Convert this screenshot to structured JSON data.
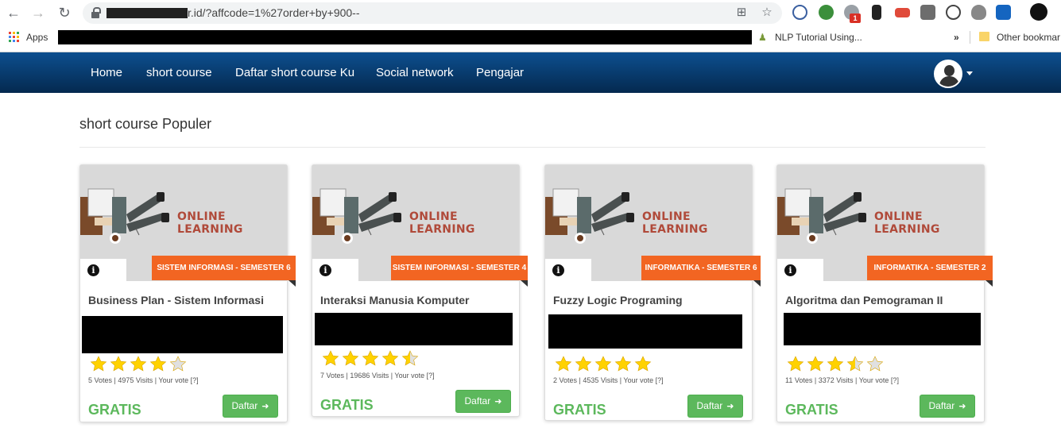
{
  "browser": {
    "url": "r.id/?affcode=1%27order+by+900--",
    "ext_badge": "1",
    "bookmarks": {
      "apps_label": "Apps",
      "item1": "NLP Tutorial Using...",
      "more": "»",
      "other": "Other bookmar"
    }
  },
  "nav": {
    "home": "Home",
    "short_course": "short course",
    "daftar": "Daftar short course Ku",
    "social": "Social network",
    "pengajar": "Pengajar"
  },
  "section_title": "short course Populer",
  "courses": [
    {
      "thumb_text": "ONLINE LEARNING",
      "ribbon": "SISTEM INFORMASI - SEMESTER 6",
      "title": "Business Plan - Sistem Informasi",
      "rating": 4,
      "votes": "5 Votes | 4975 Visits | Your vote [?]",
      "price": "GRATIS",
      "button": "Daftar"
    },
    {
      "thumb_text": "ONLINE LEARNING",
      "ribbon": "SISTEM INFORMASI - SEMESTER 4",
      "title": "Interaksi Manusia Komputer",
      "rating": 4.5,
      "votes": "7 Votes | 19686 Visits | Your vote [?]",
      "price": "GRATIS",
      "button": "Daftar"
    },
    {
      "thumb_text": "ONLINE LEARNING",
      "ribbon": "INFORMATIKA - SEMESTER 6",
      "title": "Fuzzy Logic Programing",
      "rating": 5,
      "votes": "2 Votes | 4535 Visits | Your vote [?]",
      "price": "GRATIS",
      "button": "Daftar"
    },
    {
      "thumb_text": "ONLINE LEARNING",
      "ribbon": "INFORMATIKA - SEMESTER 2",
      "title": "Algoritma dan Pemograman II",
      "rating": 3.5,
      "votes": "11 Votes | 3372 Visits | Your vote [?]",
      "price": "GRATIS",
      "button": "Daftar"
    }
  ],
  "colors": {
    "nav_top": "#0d4f8f",
    "nav_bottom": "#04294f",
    "ribbon": "#f26522",
    "green": "#5cb85c",
    "star": "#ffd200"
  }
}
